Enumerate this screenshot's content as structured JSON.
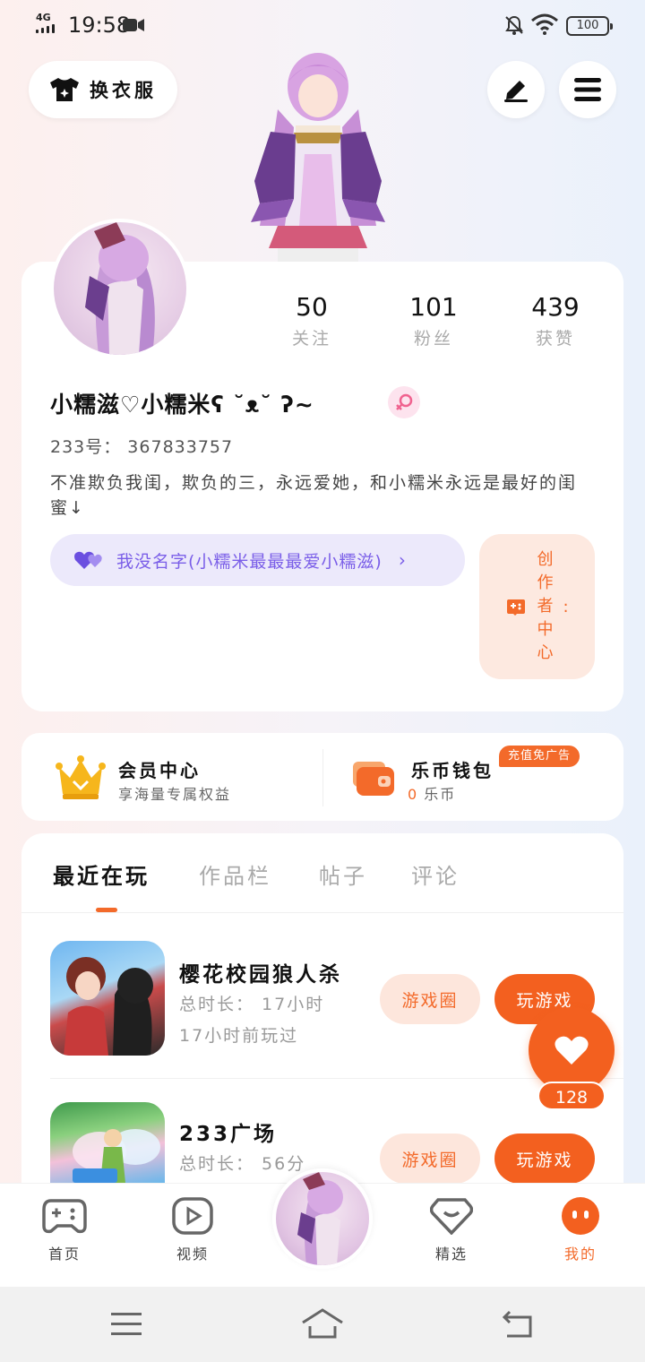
{
  "status_bar": {
    "network": "4G",
    "time": "19:58",
    "battery": "100"
  },
  "header": {
    "outfit_label": "换衣服"
  },
  "profile": {
    "stats": [
      {
        "value": "50",
        "label": "关注"
      },
      {
        "value": "101",
        "label": "粉丝"
      },
      {
        "value": "439",
        "label": "获赞"
      }
    ],
    "username": "小糯滋♡小糯米ʕ ˘ᴥ˘ ʔ~",
    "user_id": "233号： 367833757",
    "bio": "不准欺负我闺，欺负的三，永远爱她，和小糯米永远是最好的闺蜜↓",
    "family_pill": "我没名字(小糯米最最最爱小糯滋)",
    "creator_center": "创作者中心"
  },
  "wallet": {
    "vip_title": "会员中心",
    "vip_sub": "享海量专属权益",
    "wallet_title": "乐币钱包",
    "wallet_amount": "0",
    "wallet_unit": "乐币",
    "ad_badge": "充值免广告"
  },
  "tabs": [
    "最近在玩",
    "作品栏",
    "帖子",
    "评论"
  ],
  "games": [
    {
      "name": "樱花校园狼人杀",
      "duration": "总时长： 17小时",
      "last_played": "17小时前玩过",
      "circle_btn": "游戏圈",
      "play_btn": "玩游戏"
    },
    {
      "name": "233广场",
      "duration": "总时长： 56分",
      "circle_btn": "游戏圈",
      "play_btn": "玩游戏"
    }
  ],
  "like_count": "128",
  "bottom_nav": [
    {
      "label": "首页"
    },
    {
      "label": "视频"
    },
    {
      "label": "精选"
    },
    {
      "label": "我的"
    }
  ],
  "colors": {
    "accent": "#f3601f",
    "accent_light": "#fde6dc",
    "purple": "#7a5ee8",
    "purple_light": "#ece9fb"
  },
  "icons": {
    "outfit": "tshirt-icon",
    "edit": "pen-icon",
    "menu": "hamburger-icon",
    "gender": "female-icon",
    "family": "heart-icon",
    "creator": "gamepad-icon",
    "vip": "crown-icon",
    "wallet": "wallet-icon",
    "like": "heart-icon"
  }
}
